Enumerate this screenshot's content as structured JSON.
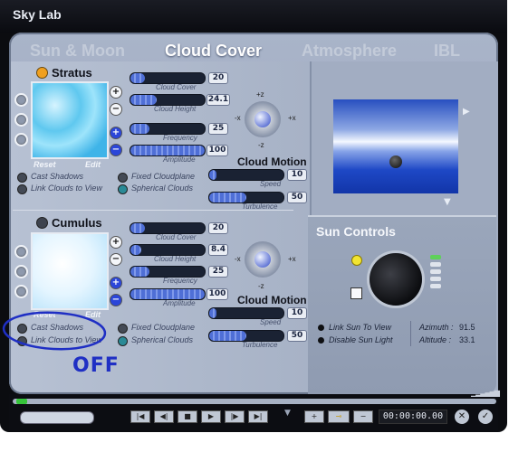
{
  "window": {
    "title": "Sky Lab"
  },
  "tabs": [
    {
      "label": "Sun & Moon"
    },
    {
      "label": "Cloud Cover"
    },
    {
      "label": "Atmosphere"
    },
    {
      "label": "IBL"
    }
  ],
  "stratus": {
    "title": "Stratus",
    "reset": "Reset",
    "edit": "Edit",
    "cast_shadows": "Cast Shadows",
    "link_clouds": "Link Clouds to View",
    "fixed_plane": "Fixed Cloudplane",
    "spherical": "Spherical Clouds",
    "sliders": [
      {
        "label": "Cloud Cover",
        "value": "20",
        "level": 0.2
      },
      {
        "label": "Cloud Height",
        "value": "24.1",
        "level": 0.35
      },
      {
        "label": "Frequency",
        "value": "25",
        "level": 0.25
      },
      {
        "label": "Amplitude",
        "value": "100",
        "level": 1.0
      }
    ],
    "motion_title": "Cloud Motion",
    "speed": {
      "label": "Speed",
      "value": "10",
      "level": 0.1
    },
    "turbulence": {
      "label": "Turbulence",
      "value": "50",
      "level": 0.5
    }
  },
  "cumulus": {
    "title": "Cumulus",
    "reset": "Reset",
    "edit": "Edit",
    "cast_shadows": "Cast Shadows",
    "link_clouds": "Link Clouds to View",
    "fixed_plane": "Fixed Cloudplane",
    "spherical": "Spherical Clouds",
    "sliders": [
      {
        "label": "Cloud Cover",
        "value": "20",
        "level": 0.2
      },
      {
        "label": "Cloud Height",
        "value": "8.4",
        "level": 0.15
      },
      {
        "label": "Frequency",
        "value": "25",
        "level": 0.25
      },
      {
        "label": "Amplitude",
        "value": "100",
        "level": 1.0
      }
    ],
    "motion_title": "Cloud Motion",
    "speed": {
      "label": "Speed",
      "value": "10",
      "level": 0.1
    },
    "turbulence": {
      "label": "Turbulence",
      "value": "50",
      "level": 0.5
    }
  },
  "axes": {
    "plus_z": "+z",
    "minus_z": "-z",
    "minus_x": "-x",
    "plus_x": "+x"
  },
  "sun": {
    "title": "Sun Controls",
    "link_sun": "Link Sun To View",
    "disable_light": "Disable Sun Light",
    "azimuth_label": "Azimuth :",
    "azimuth_value": "91.5",
    "altitude_label": "Altitude :",
    "altitude_value": "33.1"
  },
  "annotation": {
    "text": "OFF"
  },
  "playback": {
    "time": "00:00:00.00"
  },
  "colors": {
    "accent": "#3b5bdb",
    "annotation": "#1f2fc4"
  }
}
